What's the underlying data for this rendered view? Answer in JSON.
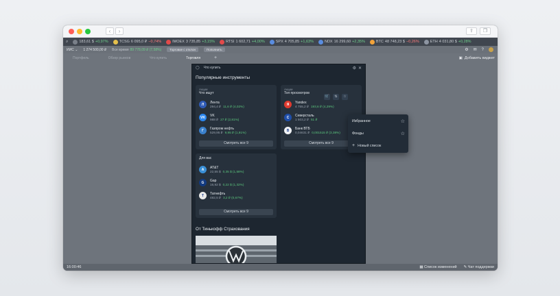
{
  "ticker": [
    {
      "name": "",
      "price": "183,61 $",
      "change": "+0,97%",
      "dir": "pos",
      "color": "#7a8089"
    },
    {
      "name": "TCSG",
      "price": "6 095,0 ₽",
      "change": "−0,74%",
      "dir": "neg",
      "color": "#e5c04c"
    },
    {
      "name": "IMOEX",
      "price": "3 735,85",
      "change": "+3,15%",
      "dir": "pos",
      "color": "#e24a4a"
    },
    {
      "name": "RTSI",
      "price": "1 602,71",
      "change": "+4,00%",
      "dir": "pos",
      "color": "#e24a4a"
    },
    {
      "name": "SPX",
      "price": "4 705,85",
      "change": "+1,63%",
      "dir": "pos",
      "color": "#5a8de0"
    },
    {
      "name": "NDX",
      "price": "16 299,60",
      "change": "+2,35%",
      "dir": "pos",
      "color": "#5a8de0"
    },
    {
      "name": "BTC",
      "price": "48 748,23 $",
      "change": "−0,26%",
      "dir": "neg",
      "color": "#f2a33a"
    },
    {
      "name": "ETH",
      "price": "4 031,80 $",
      "change": "+0,28%",
      "dir": "pos",
      "color": "#8d95a2"
    }
  ],
  "account": {
    "name": "ИИС ⌄",
    "balance": "1 274 500,00 ₽",
    "alltime_label": "Все время",
    "alltime_value": "89 778,09 ₽ (7,58%)",
    "chip1": "Торговое с отклон",
    "chip2": "Пополнить"
  },
  "tabs": [
    "Портфель",
    "Обзор рынков",
    "Что купить",
    "Торговля"
  ],
  "add_widget": "Добавить виджет",
  "status": {
    "time": "16:00:46",
    "changelog": "Список изменений",
    "support": "Чат поддержки"
  },
  "widget": {
    "header": "Что купить",
    "title": "Популярные инструменты",
    "cards": [
      {
        "category": "Акции",
        "subtitle": "Что ищут",
        "items": [
          {
            "name": "Лента",
            "price": "294,4 ₽",
            "change": "11,6 ₽ (4,02%)",
            "color": "#2f5bb7",
            "glyph": "Л"
          },
          {
            "name": "VK",
            "price": "988 ₽",
            "change": "27 ₽ (2,81%)",
            "color": "#2a86f0",
            "glyph": "VK"
          },
          {
            "name": "Газпром нефть",
            "price": "529,95 ₽",
            "change": "9,95 ₽ (1,91%)",
            "color": "#3a80cc",
            "glyph": "Г"
          }
        ],
        "see_all": "Смотреть все 9"
      },
      {
        "category": "Акции",
        "subtitle": "Топ просмотров",
        "items": [
          {
            "name": "Yandex",
            "price": "4 755,2 ₽",
            "change": "193,6 ₽ (4,29%)",
            "color": "#e03a2f",
            "glyph": "Я"
          },
          {
            "name": "Северсталь",
            "price": "1 503,2 ₽",
            "change": "51 ₽",
            "color": "#1f4ea8",
            "glyph": "С"
          },
          {
            "name": "Банк ВТБ",
            "price": "0,04631 ₽",
            "change": "0,001515 ₽ (3,38%)",
            "color": "#f0f2f5",
            "glyph": "В"
          }
        ],
        "see_all": "Смотреть все 9"
      },
      {
        "category": "",
        "subtitle": "Для вас",
        "items": [
          {
            "name": "AT&T",
            "price": "22,55 $",
            "change": "0,35 $ (1,58%)",
            "color": "#3a8fd6",
            "glyph": "A"
          },
          {
            "name": "Gap",
            "price": "16,92 $",
            "change": "0,22 $ (1,32%)",
            "color": "#123a80",
            "glyph": "G"
          },
          {
            "name": "Татнефть",
            "price": "482,5 ₽",
            "change": "3,2 ₽ (0,67%)",
            "color": "#e9e9e9",
            "glyph": "Т"
          }
        ],
        "see_all": "Смотреть все 9"
      }
    ],
    "section2_title": "От Тинькофф Страхования"
  },
  "dropdown": {
    "items": [
      "Избранное",
      "Фонды"
    ],
    "new_list": "Новый список"
  }
}
